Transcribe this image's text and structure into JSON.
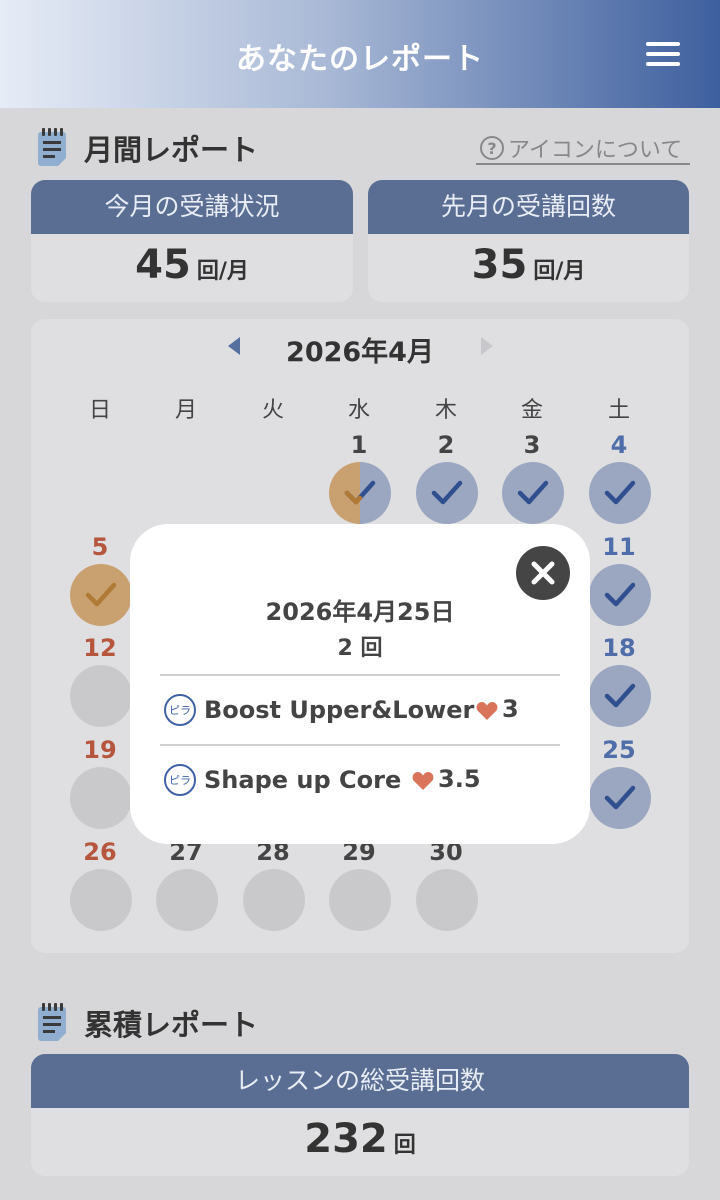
{
  "header": {
    "title": "あなたのレポート"
  },
  "monthly": {
    "section_title": "月間レポート",
    "help_label": "アイコンについて",
    "help_icon": "?",
    "this_month": {
      "label": "今月の受講状況",
      "value": "45",
      "unit": "回/月"
    },
    "last_month": {
      "label": "先月の受講回数",
      "value": "35",
      "unit": "回/月"
    }
  },
  "calendar": {
    "month_label": "2026年4月",
    "weekdays": [
      "日",
      "月",
      "火",
      "水",
      "木",
      "金",
      "土"
    ],
    "days": [
      "1",
      "2",
      "3",
      "4",
      "5",
      "11",
      "12",
      "18",
      "19",
      "25",
      "26",
      "27",
      "28",
      "29",
      "30"
    ]
  },
  "modal": {
    "date": "2026年4月25日",
    "count": "2 回",
    "lessons": [
      {
        "badge": "ピラ",
        "name": "Boost Upper&Lower",
        "rating": "3"
      },
      {
        "badge": "ピラ",
        "name": "Shape up Core",
        "rating": "3.5"
      }
    ]
  },
  "cumulative": {
    "section_title": "累積レポート",
    "total": {
      "label": "レッスンの総受講回数",
      "value": "232",
      "unit": "回"
    }
  },
  "colors": {
    "accent": "#3e5f9e",
    "card_header": "#5a6e93",
    "check_blue": "#2f4f8f",
    "check_orange": "#c9a170",
    "sunday": "#b5563d",
    "saturday": "#4f6ea9",
    "heart": "#d9735a"
  }
}
